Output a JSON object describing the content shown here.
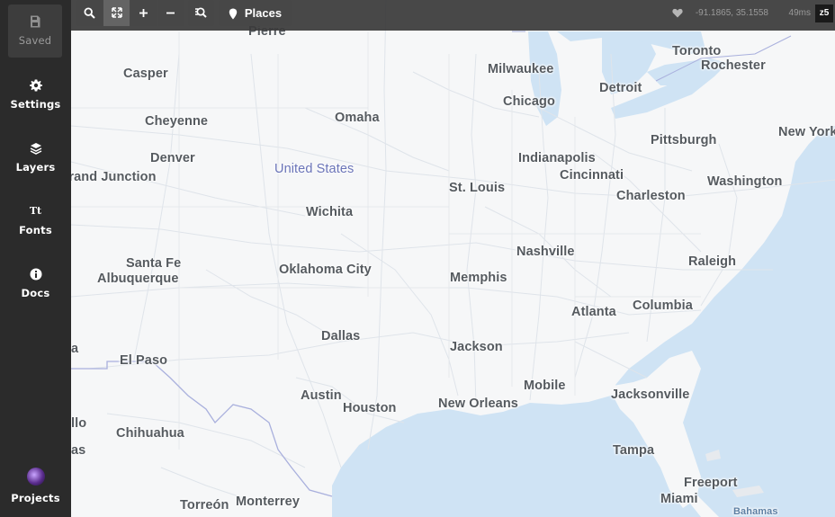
{
  "sidebar": {
    "saved": {
      "label": "Saved",
      "icon": "save-icon"
    },
    "settings": {
      "label": "Settings",
      "icon": "gear-icon"
    },
    "layers": {
      "label": "Layers",
      "icon": "layers-icon"
    },
    "fonts": {
      "label": "Fonts",
      "icon": "fonts-icon",
      "glyph": "Tt"
    },
    "docs": {
      "label": "Docs",
      "icon": "info-icon"
    },
    "projects": {
      "label": "Projects",
      "icon": "avatar"
    }
  },
  "toolbar": {
    "places_label": "Places",
    "coords": "-91.1865, 35.1558",
    "render_time": "49ms",
    "zoom": "z5"
  },
  "map": {
    "country_label": "United States",
    "water_label": "Bahamas",
    "cities": [
      "Pierre",
      "Casper",
      "Milwaukee",
      "Toronto",
      "Rochester",
      "Detroit",
      "Chicago",
      "Cheyenne",
      "Omaha",
      "Pittsburgh",
      "New York",
      "Denver",
      "Indianapolis",
      "Cincinnati",
      "Grand Junction",
      "St. Louis",
      "Washington",
      "Charleston",
      "Wichita",
      "Nashville",
      "Santa Fe",
      "Albuquerque",
      "Oklahoma City",
      "Raleigh",
      "Memphis",
      "Columbia",
      "Atlanta",
      "Dallas",
      "Jackson",
      "El Paso",
      "Mobile",
      "Austin",
      "Jacksonville",
      "Houston",
      "New Orleans",
      "Chihuahua",
      "Tampa",
      "Freeport",
      "Miami",
      "Torreón",
      "Monterrey",
      "llo",
      "as",
      "a"
    ],
    "colors": {
      "land": "#f6f7f8",
      "water": "#cfe3f4",
      "roads": "#dde3ea",
      "border": "#a9b0dd"
    }
  }
}
